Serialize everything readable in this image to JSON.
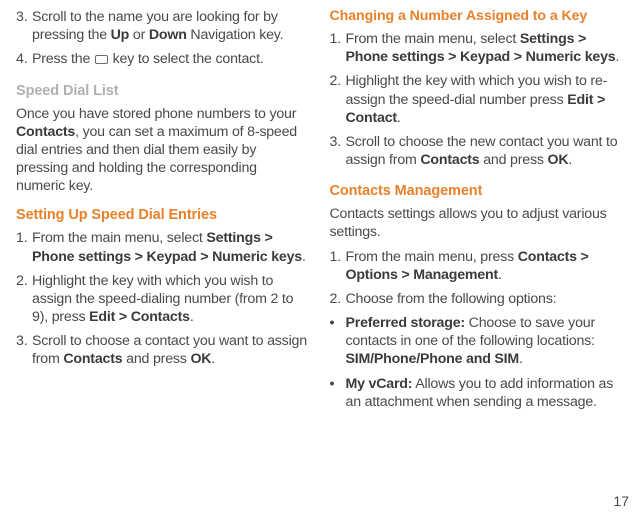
{
  "col1": {
    "step3_a": "Scroll to the name you are looking for by pressing the ",
    "step3_up": "Up",
    "step3_or": " or ",
    "step3_down": "Down",
    "step3_b": " Navigation key.",
    "step4_a": "Press the ",
    "step4_b": " key to select the contact.",
    "heading_gray": "Speed Dial List",
    "para_a": "Once you have stored phone numbers to your ",
    "para_contacts": "Contacts",
    "para_b": ", you can set a maximum of 8-speed dial entries and then dial them easily by pressing and holding the corresponding numeric key.",
    "heading_orange": "Setting Up Speed Dial Entries",
    "s1_a": "From the main menu, select ",
    "s1_b": "Settings > Phone settings > Keypad > Numeric keys",
    "s1_c": ".",
    "s2_a": "Highlight the key with which you wish to assign the speed-dialing number (from 2 to 9), press ",
    "s2_b": "Edit > Contacts",
    "s2_c": ".",
    "s3_a": "Scroll to choose a contact you want to assign from ",
    "s3_b": "Contacts",
    "s3_c": " and press ",
    "s3_d": "OK",
    "s3_e": "."
  },
  "col2": {
    "heading_orange1": "Changing a Number Assigned to a Key",
    "c1_a": "From the main menu, select ",
    "c1_b": "Settings > Phone settings > Keypad > Numeric keys",
    "c1_c": ".",
    "c2_a": "Highlight the key with which you wish to re-assign the speed-dial number press ",
    "c2_b": "Edit > Contact",
    "c2_c": ".",
    "c3_a": "Scroll to choose the new contact you want to assign from ",
    "c3_b": "Contacts",
    "c3_c": " and press ",
    "c3_d": "OK",
    "c3_e": ".",
    "heading_gray2": "Contacts Management",
    "para2": "Contacts settings allows you to adjust various settings.",
    "m1_a": "From the main menu, press ",
    "m1_b": "Contacts > Options > Management",
    "m1_c": ".",
    "m2": "Choose from the following options:",
    "b1_label": "Preferred storage:",
    "b1_a": " Choose to save your contacts in one of the following locations: ",
    "b1_b": "SIM/Phone/Phone and SIM",
    "b1_c": ".",
    "b2_label": "My vCard:",
    "b2_a": " Allows you to add information as an attachment when sending a message."
  },
  "page": "17",
  "nums": {
    "n1": "1.",
    "n2": "2.",
    "n3": "3.",
    "n4": "4."
  },
  "bullet": "•"
}
